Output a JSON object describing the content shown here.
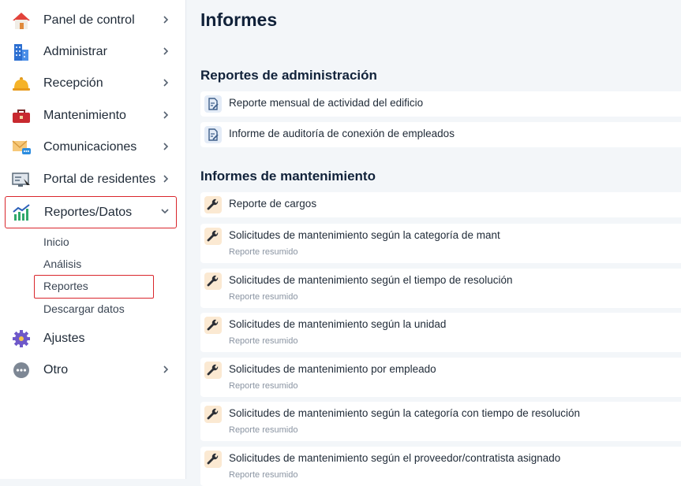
{
  "sidebar": {
    "items": [
      {
        "label": "Panel de control",
        "icon": "house-icon",
        "chevron": true
      },
      {
        "label": "Administrar",
        "icon": "building-icon",
        "chevron": true
      },
      {
        "label": "Recepción",
        "icon": "service-bell-icon",
        "chevron": true
      },
      {
        "label": "Mantenimiento",
        "icon": "toolbox-icon",
        "chevron": true
      },
      {
        "label": "Comunicaciones",
        "icon": "envelope-chat-icon",
        "chevron": true
      },
      {
        "label": "Portal de residentes",
        "icon": "monitor-portal-icon",
        "chevron": true
      },
      {
        "label": "Reportes/Datos",
        "icon": "bar-chart-icon",
        "chevron": true,
        "expanded": true
      },
      {
        "label": "Ajustes",
        "icon": "gear-icon",
        "chevron": false
      },
      {
        "label": "Otro",
        "icon": "more-dots-icon",
        "chevron": true
      }
    ],
    "subitems": [
      {
        "label": "Inicio"
      },
      {
        "label": "Análisis"
      },
      {
        "label": "Reportes",
        "current": true
      },
      {
        "label": "Descargar datos"
      }
    ]
  },
  "main": {
    "title": "Informes",
    "sections": [
      {
        "title": "Reportes de administración",
        "reports": [
          {
            "title": "Reporte mensual de actividad del edificio",
            "icon": "document-edit-icon"
          },
          {
            "title": "Informe de auditoría de conexión de empleados",
            "icon": "document-edit-icon"
          }
        ]
      },
      {
        "title": "Informes de mantenimiento",
        "reports": [
          {
            "title": "Reporte de cargos",
            "icon": "wrench-icon"
          },
          {
            "title": "Solicitudes de mantenimiento según la categoría de mant",
            "subtitle": "Reporte resumido",
            "icon": "wrench-icon"
          },
          {
            "title": "Solicitudes de mantenimiento según el tiempo de resolución",
            "subtitle": "Reporte resumido",
            "icon": "wrench-icon"
          },
          {
            "title": "Solicitudes de mantenimiento según la unidad",
            "subtitle": "Reporte resumido",
            "icon": "wrench-icon"
          },
          {
            "title": "Solicitudes de mantenimiento por empleado",
            "subtitle": "Reporte resumido",
            "icon": "wrench-icon"
          },
          {
            "title": "Solicitudes de mantenimiento según la categoría con tiempo de resolución",
            "subtitle": "Reporte resumido",
            "icon": "wrench-icon"
          },
          {
            "title": "Solicitudes de mantenimiento según el proveedor/contratista asignado",
            "subtitle": "Reporte resumido",
            "icon": "wrench-icon"
          }
        ]
      }
    ]
  },
  "colors": {
    "highlight_border": "#d9262c",
    "doc_icon_bg": "#e4ecf7",
    "wrench_icon_bg": "#fbe9d2",
    "title_text": "#11223a"
  }
}
